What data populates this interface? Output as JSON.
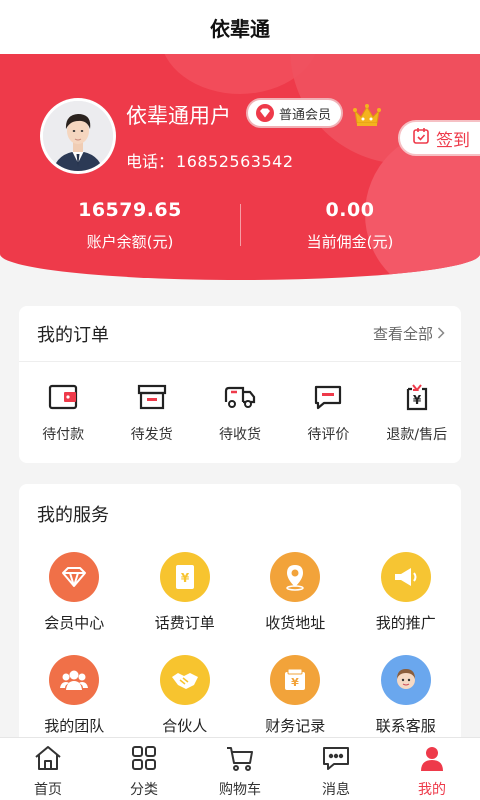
{
  "header": {
    "title": "依辈通"
  },
  "profile": {
    "name": "依辈通用户",
    "member_level": "普通会员",
    "phone_label": "电话：",
    "phone": "16852563542",
    "signin_label": "签到"
  },
  "stats": {
    "balance_value": "16579.65",
    "balance_label": "账户余额(元)",
    "commission_value": "0.00",
    "commission_label": "当前佣金(元)"
  },
  "orders": {
    "title": "我的订单",
    "view_all": "查看全部",
    "items": [
      {
        "label": "待付款",
        "icon": "wallet-icon"
      },
      {
        "label": "待发货",
        "icon": "package-box-icon"
      },
      {
        "label": "待收货",
        "icon": "delivery-truck-icon"
      },
      {
        "label": "待评价",
        "icon": "comment-icon"
      },
      {
        "label": "退款/售后",
        "icon": "refund-icon"
      }
    ]
  },
  "services": {
    "title": "我的服务",
    "items": [
      {
        "label": "会员中心",
        "icon": "diamond-icon",
        "color": "#f07048"
      },
      {
        "label": "话费订单",
        "icon": "yen-card-icon",
        "color": "#f7c42f"
      },
      {
        "label": "收货地址",
        "icon": "location-pin-icon",
        "color": "#f2a33a"
      },
      {
        "label": "我的推广",
        "icon": "megaphone-icon",
        "color": "#f6c533"
      },
      {
        "label": "我的团队",
        "icon": "team-icon",
        "color": "#f07048"
      },
      {
        "label": "合伙人",
        "icon": "handshake-icon",
        "color": "#f7c42f"
      },
      {
        "label": "财务记录",
        "icon": "finance-icon",
        "color": "#f2a33a"
      },
      {
        "label": "联系客服",
        "icon": "customer-service-icon",
        "color": "#6aa7ee"
      }
    ]
  },
  "tabbar": {
    "items": [
      {
        "label": "首页",
        "icon": "home-icon",
        "active": false
      },
      {
        "label": "分类",
        "icon": "category-grid-icon",
        "active": false
      },
      {
        "label": "购物车",
        "icon": "cart-icon",
        "active": false
      },
      {
        "label": "消息",
        "icon": "message-icon",
        "active": false
      },
      {
        "label": "我的",
        "icon": "user-icon",
        "active": true
      }
    ]
  },
  "colors": {
    "primary": "#ee3a4a",
    "hero_bg": "#ee3a4a",
    "gold": "#f4b31e"
  }
}
